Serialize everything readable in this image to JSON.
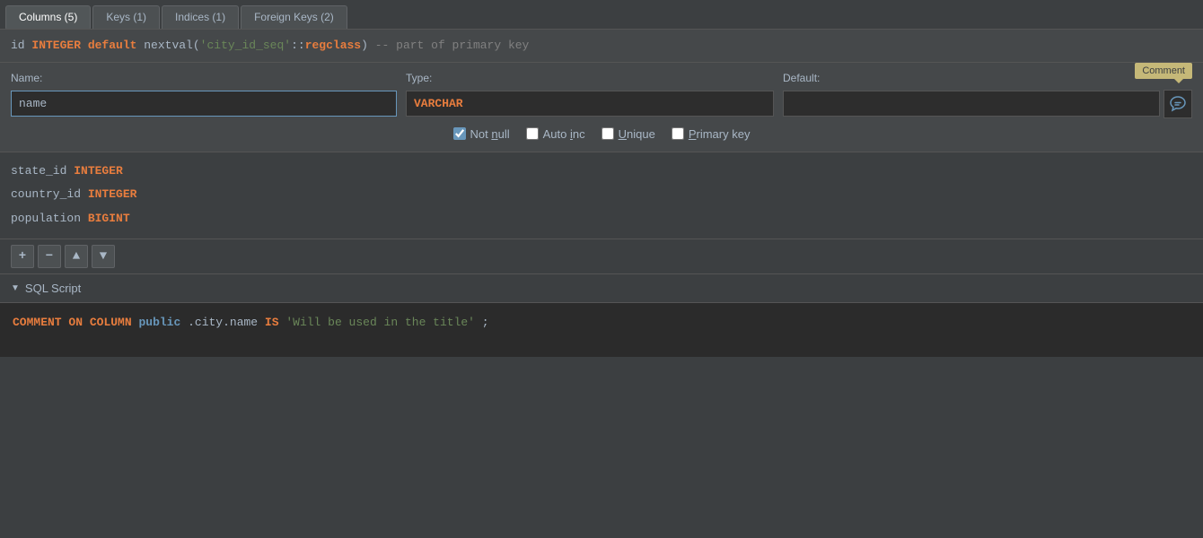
{
  "tabs": [
    {
      "label": "Columns (5)",
      "active": true
    },
    {
      "label": "Keys (1)",
      "active": false
    },
    {
      "label": "Indices (1)",
      "active": false
    },
    {
      "label": "Foreign Keys (2)",
      "active": false
    }
  ],
  "sql_header": {
    "prefix": "id",
    "type": "INTEGER",
    "middle": "default nextval(",
    "string": "'city_id_seq'",
    "separator": "::",
    "cast": "regclass",
    "suffix": ") -- part of primary key"
  },
  "fields": {
    "name_label": "Name:",
    "type_label": "Type:",
    "default_label": "Default:",
    "name_value": "name",
    "type_value": "VARCHAR",
    "default_value": "",
    "comment_tooltip": "Comment"
  },
  "checkboxes": {
    "not_null_label": "Not null",
    "not_null_checked": true,
    "auto_inc_label": "Auto inc",
    "auto_inc_checked": false,
    "unique_label": "Unique",
    "unique_checked": false,
    "primary_key_label": "Primary key",
    "primary_key_checked": false
  },
  "columns": [
    {
      "name": "state_id",
      "type": "INTEGER"
    },
    {
      "name": "country_id",
      "type": "INTEGER"
    },
    {
      "name": "population",
      "type": "BIGINT"
    }
  ],
  "toolbar": {
    "add_label": "+",
    "remove_label": "−",
    "up_label": "▲",
    "down_label": "▼"
  },
  "sql_script": {
    "section_label": "SQL Script",
    "chevron": "▼",
    "keyword1": "COMMENT",
    "keyword2": "ON",
    "keyword3": "COLUMN",
    "keyword4": "public",
    "keyword5": "IS",
    "path": ".city.name",
    "string_value": "'Will be used in the title'",
    "semicolon": ";"
  }
}
